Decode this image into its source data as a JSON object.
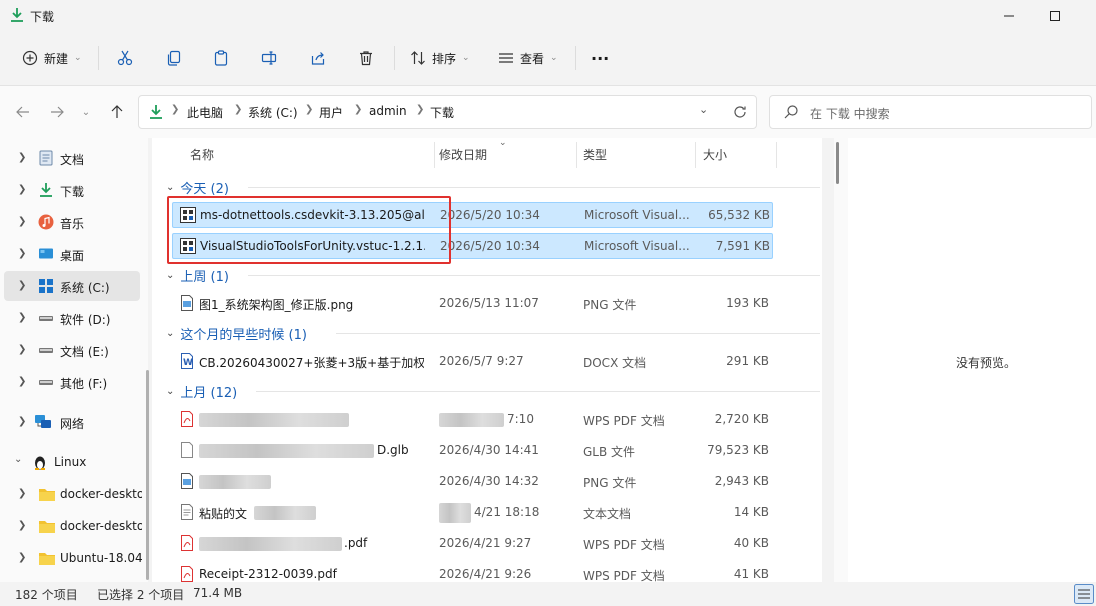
{
  "window": {
    "title": "下载"
  },
  "toolbar": {
    "new_label": "新建",
    "sort_label": "排序",
    "view_label": "查看",
    "more_label": "···"
  },
  "address": {
    "crumbs": [
      "此电脑",
      "系统 (C:)",
      "用户",
      "admin",
      "下载"
    ],
    "search_placeholder": "在 下载 中搜索"
  },
  "nav": {
    "items": [
      {
        "label": "文档",
        "icon": "documents-icon"
      },
      {
        "label": "下载",
        "icon": "download-icon"
      },
      {
        "label": "音乐",
        "icon": "music-icon"
      },
      {
        "label": "桌面",
        "icon": "desktop-icon"
      },
      {
        "label": "系统 (C:)",
        "icon": "drive-c-icon",
        "selected": true
      },
      {
        "label": "软件 (D:)",
        "icon": "drive-icon"
      },
      {
        "label": "文档 (E:)",
        "icon": "drive-icon"
      },
      {
        "label": "其他 (F:)",
        "icon": "drive-icon"
      },
      {
        "label": "网络",
        "icon": "network-icon"
      },
      {
        "label": "Linux",
        "icon": "linux-icon"
      },
      {
        "label": "docker-deskto",
        "icon": "folder-icon"
      },
      {
        "label": "docker-deskto",
        "icon": "folder-icon"
      },
      {
        "label": "Ubuntu-18.04",
        "icon": "folder-icon"
      }
    ]
  },
  "columns": {
    "name": "名称",
    "date": "修改日期",
    "type": "类型",
    "size": "大小"
  },
  "groups": [
    {
      "label": "今天 (2)"
    },
    {
      "label": "上周 (1)"
    },
    {
      "label": "这个月的早些时候 (1)"
    },
    {
      "label": "上月 (12)"
    }
  ],
  "files": [
    {
      "name": "ms-dotnettools.csdevkit-3.13.205@al...",
      "date": "2026/5/20 10:34",
      "type": "Microsoft Visual...",
      "size": "65,532 KB",
      "icon": "vsix-file-icon",
      "selected": true
    },
    {
      "name": "VisualStudioToolsForUnity.vstuc-1.2.1...",
      "date": "2026/5/20 10:34",
      "type": "Microsoft Visual...",
      "size": "7,591 KB",
      "icon": "vsix-file-icon",
      "selected": true
    },
    {
      "name": "图1_系统架构图_修正版.png",
      "date": "2026/5/13 11:07",
      "type": "PNG 文件",
      "size": "193 KB",
      "icon": "image-file-icon"
    },
    {
      "name": "CB.20260430027+张菱+3版+基于加权...",
      "date": "2026/5/7 9:27",
      "type": "DOCX 文档",
      "size": "291 KB",
      "icon": "word-file-icon"
    },
    {
      "name": "",
      "date": "7:10",
      "type": "WPS PDF 文档",
      "size": "2,720 KB",
      "icon": "pdf-file-icon"
    },
    {
      "name": "D.glb",
      "date": "2026/4/30 14:41",
      "type": "GLB 文件",
      "size": "79,523 KB",
      "icon": "generic-file-icon"
    },
    {
      "name": "",
      "date": "2026/4/30 14:32",
      "type": "PNG 文件",
      "size": "2,943 KB",
      "icon": "image-file-icon"
    },
    {
      "name": "粘贴的文",
      "date": "4/21 18:18",
      "type": "文本文档",
      "size": "14 KB",
      "icon": "text-file-icon"
    },
    {
      "name": ".pdf",
      "date": "2026/4/21 9:27",
      "type": "WPS PDF 文档",
      "size": "40 KB",
      "icon": "pdf-file-icon"
    },
    {
      "name": "Receipt-2312-0039.pdf",
      "date": "2026/4/21 9:26",
      "type": "WPS PDF 文档",
      "size": "41 KB",
      "icon": "pdf-file-icon"
    }
  ],
  "preview": {
    "message": "没有预览。"
  },
  "status": {
    "count": "182 个项目",
    "selection": "已选择 2 个项目",
    "size": "71.4 MB"
  }
}
